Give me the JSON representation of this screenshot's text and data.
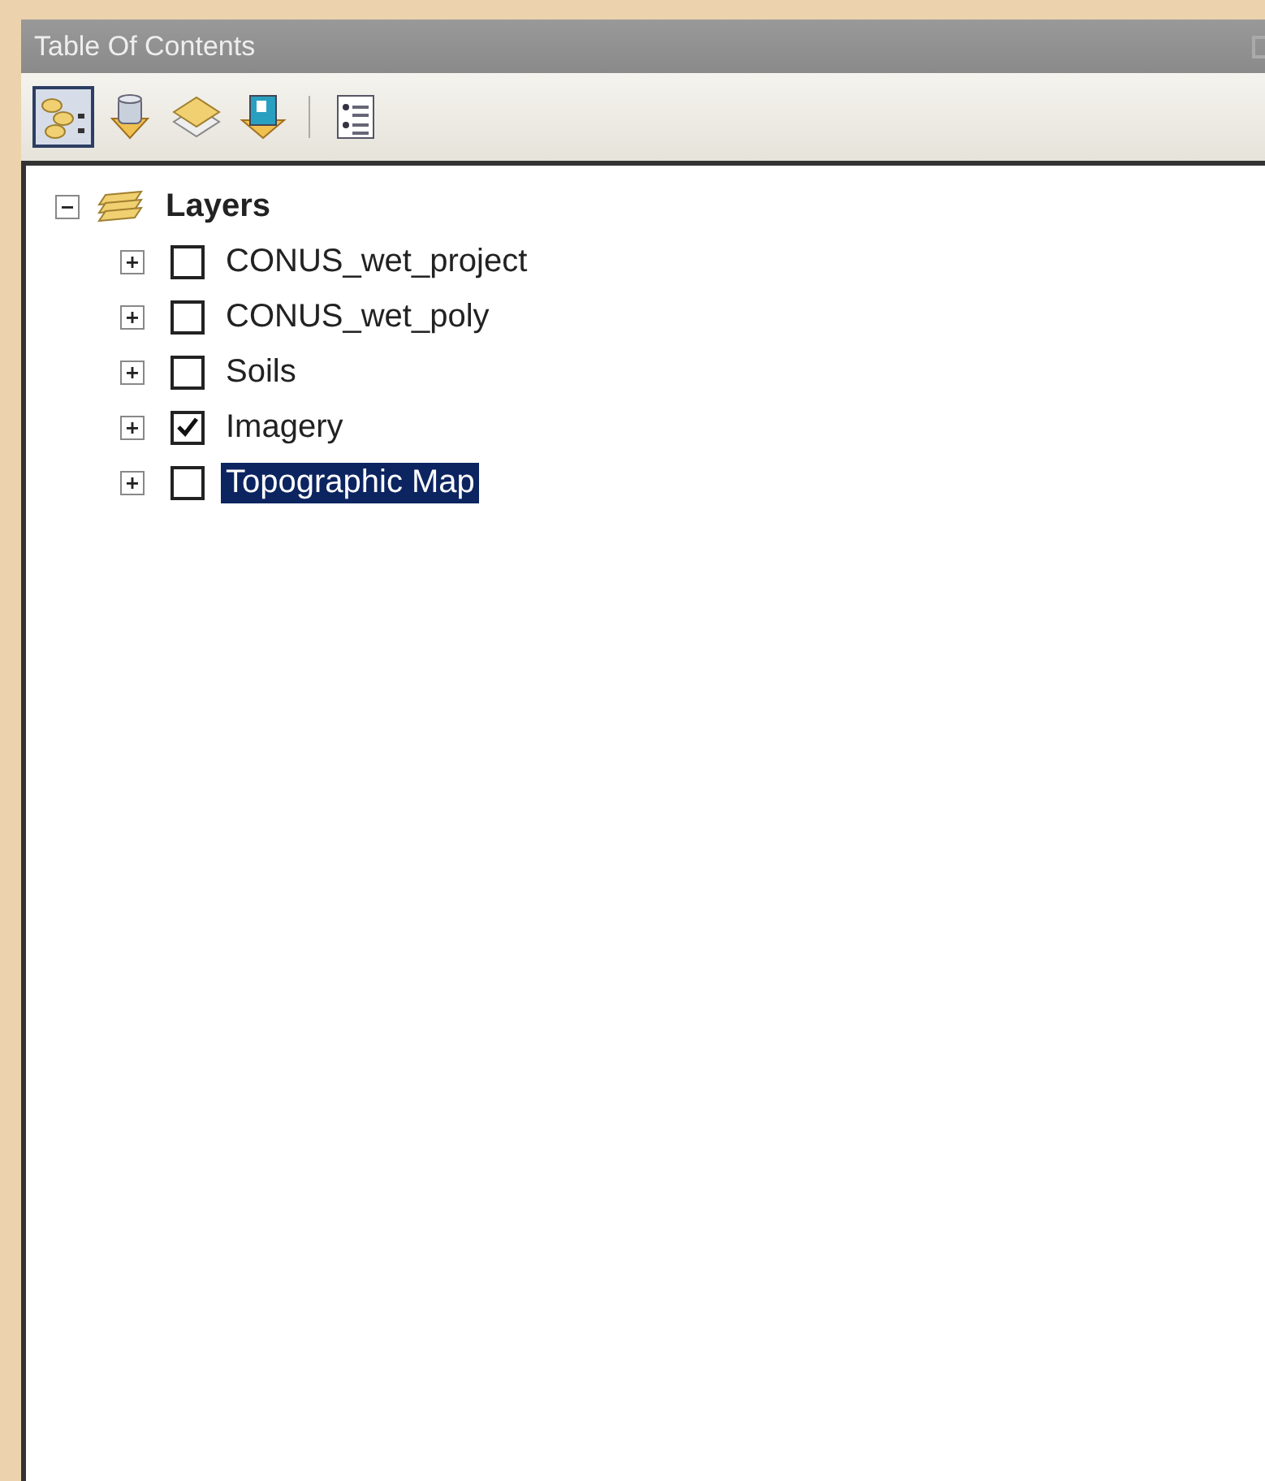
{
  "window": {
    "title": "Table Of Contents"
  },
  "toolbar": [
    {
      "kind": "list-by-drawing-order",
      "selected": true
    },
    {
      "kind": "list-by-source",
      "selected": false
    },
    {
      "kind": "list-by-visibility",
      "selected": false
    },
    {
      "kind": "list-by-selection",
      "selected": false
    },
    {
      "kind": "options",
      "selected": false
    }
  ],
  "tree": {
    "label": "Layers",
    "expanded": true,
    "children": [
      {
        "label": "CONUS_wet_project",
        "checked": false,
        "expanded": false,
        "selected": false
      },
      {
        "label": "CONUS_wet_poly",
        "checked": false,
        "expanded": false,
        "selected": false
      },
      {
        "label": "Soils",
        "checked": false,
        "expanded": false,
        "selected": false
      },
      {
        "label": "Imagery",
        "checked": true,
        "expanded": false,
        "selected": false
      },
      {
        "label": "Topographic Map",
        "checked": false,
        "expanded": false,
        "selected": true
      }
    ]
  }
}
